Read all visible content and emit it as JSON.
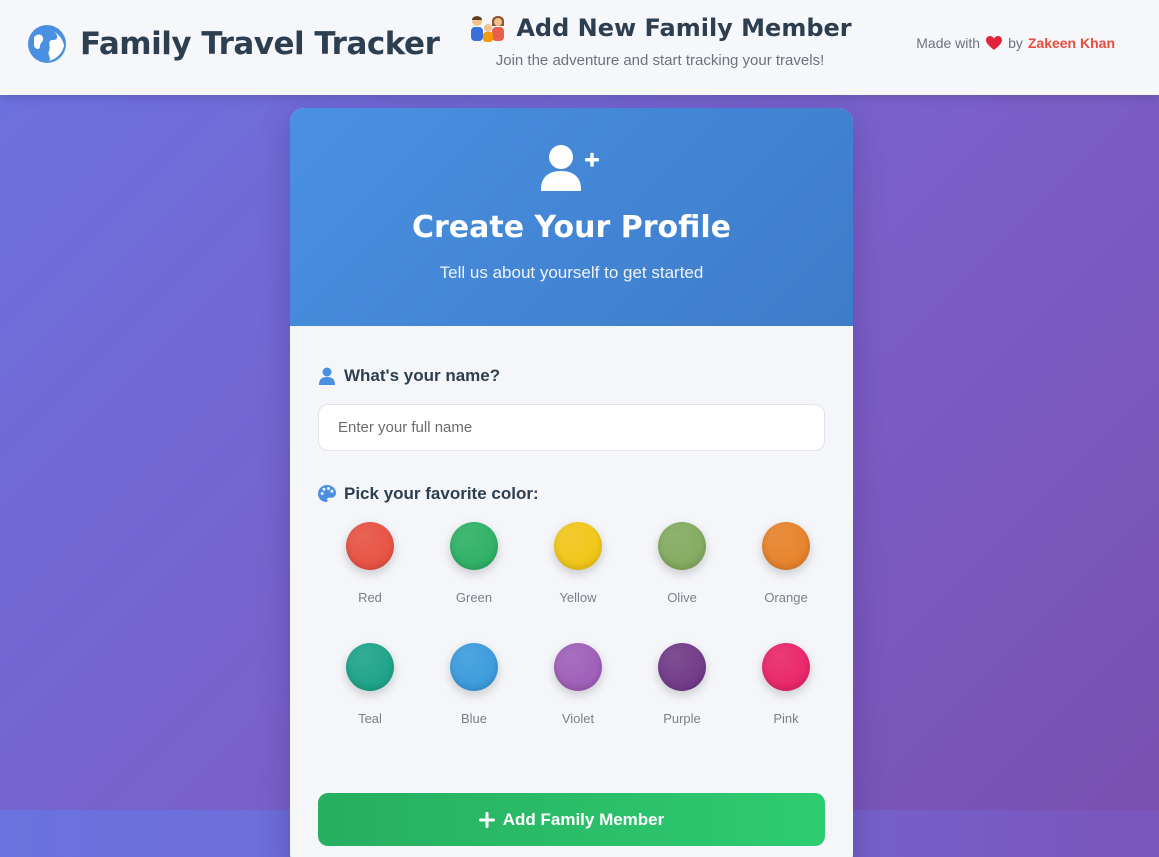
{
  "header": {
    "brand_title": "Family Travel Tracker",
    "page_title": "Add New Family Member",
    "page_subtitle": "Join the adventure and start tracking your travels!",
    "credit_prefix": "Made with",
    "credit_by": "by",
    "credit_author": "Zakeen Khan",
    "icons": [
      "globe-icon",
      "family-icon",
      "heart-icon"
    ]
  },
  "card": {
    "icon": "user-plus-icon",
    "title": "Create Your Profile",
    "subtitle": "Tell us about yourself to get started"
  },
  "form": {
    "name_label": "What's your name?",
    "name_placeholder": "Enter your full name",
    "name_value": "",
    "color_label": "Pick your favorite color:",
    "colors": [
      {
        "name": "Red",
        "hex": "#e74c3c"
      },
      {
        "name": "Green",
        "hex": "#27ae60"
      },
      {
        "name": "Yellow",
        "hex": "#f1c40f"
      },
      {
        "name": "Olive",
        "hex": "#7fa85a"
      },
      {
        "name": "Orange",
        "hex": "#e67e22"
      },
      {
        "name": "Teal",
        "hex": "#16a085"
      },
      {
        "name": "Blue",
        "hex": "#3498db"
      },
      {
        "name": "Violet",
        "hex": "#9b59b6"
      },
      {
        "name": "Purple",
        "hex": "#6c3483"
      },
      {
        "name": "Pink",
        "hex": "#e91e63"
      }
    ],
    "submit_label": "Add Family Member"
  },
  "colors": {
    "accent_blue": "#4a90e2",
    "success_green": "#2ecc71",
    "author_red": "#e74c3c",
    "header_text": "#2c3e50"
  }
}
